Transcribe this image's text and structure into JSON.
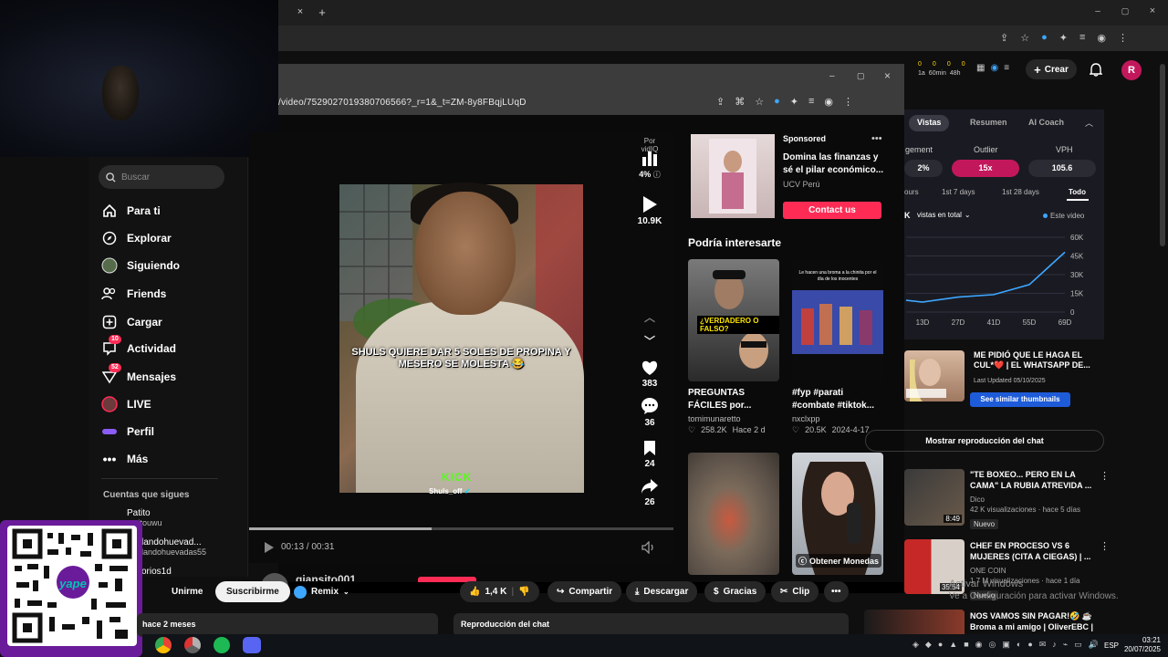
{
  "tiktok_sidebar": {
    "search_placeholder": "Buscar",
    "nav": [
      {
        "label": "Para ti"
      },
      {
        "label": "Explorar"
      },
      {
        "label": "Siguiendo"
      },
      {
        "label": "Friends"
      },
      {
        "label": "Cargar"
      },
      {
        "label": "Actividad",
        "badge": "10"
      },
      {
        "label": "Mensajes",
        "badge": "52"
      },
      {
        "label": "LIVE"
      },
      {
        "label": "Perfil"
      },
      {
        "label": "Más"
      }
    ],
    "following_title": "Cuentas que sigues",
    "following": [
      {
        "name": "Patito",
        "handle": "patitouwu"
      },
      {
        "name": "landohuevad...",
        "handle": "landohuevadas55"
      },
      {
        "name": "orios1d",
        "handle": "orios1d"
      }
    ]
  },
  "browser": {
    "url": "/video/7529027019380706566?_r=1&_t=ZM-8y8FBqjLUqD"
  },
  "video": {
    "caption": "SHULS QUIERE DAR 5 SOLES DE PROPINA Y MESERO SE MOLESTA 😂",
    "watermark": "Shuls_off",
    "time": "00:13 / 00:31",
    "progress": 0.43,
    "uploader": "giansito001"
  },
  "rail": {
    "vidiq_label": "Por vidIQ",
    "vidiq_pct": "4%",
    "plays": "10.9K",
    "likes": "383",
    "comments": "36",
    "saves": "24",
    "shares": "26"
  },
  "ad": {
    "sponsored": "Sponsored",
    "title": "Domina las finanzas y sé el pilar económico...",
    "brand": "UCV Perú",
    "cta": "Contact us"
  },
  "recommendations": {
    "title": "Podría interesarte",
    "items": [
      {
        "caption": "PREGUNTAS FÁCILES por...",
        "user": "tomimunaretto",
        "likes": "258.2K",
        "date": "Hace 2 d",
        "overlay": "¿VERDADERO O FALSO?"
      },
      {
        "caption": "#fyp #parati #combate #tiktok...",
        "user": "nxclxpp",
        "likes": "20.5K",
        "date": "2024-4-17",
        "overlay": "Le hacen una broma a la chinita por el día de los inocentes"
      },
      {
        "caption": "",
        "user": "",
        "likes": "",
        "date": "",
        "overlay": ""
      },
      {
        "caption": "",
        "user": "",
        "likes": "",
        "date": "",
        "overlay": "Obtener Monedas"
      }
    ]
  },
  "youtube_actions": {
    "unsubscribe": "Unirme",
    "subscribe": "Suscribirme",
    "remix": "Remix",
    "likes": "1,4 K",
    "share": "Compartir",
    "download": "Descargar",
    "thanks": "Gracias",
    "clip": "Clip",
    "date_partial": "hace 2 meses",
    "chat_replay": "Reproducción del chat"
  },
  "youtube_header": {
    "create": "Crear",
    "avatar_letter": "R",
    "stats": [
      "0",
      "0",
      "0",
      "0"
    ],
    "stat_labels": [
      "1a",
      "60min",
      "48h"
    ]
  },
  "vidiq": {
    "tabs": [
      "Vistas",
      "Resumen",
      "AI Coach"
    ],
    "metric_headers": [
      "gement",
      "Outlier",
      "VPH"
    ],
    "metric_values": [
      "2%",
      "15x",
      "105.6"
    ],
    "ranges": [
      "ours",
      "1st 7 days",
      "1st 28 days",
      "Todo"
    ],
    "filter": "vistas en total",
    "legend": "Este video",
    "y_ticks": [
      "60K",
      "45K",
      "30K",
      "15K",
      "0"
    ],
    "x_ticks": [
      "13D",
      "27D",
      "41D",
      "55D",
      "69D"
    ],
    "similar_title": "ME PIDIÓ QUE LE HAGA EL CUL*❤️ | EL WHATSAPP DE...",
    "similar_updated": "Last Updated 05/10/2025",
    "similar_button": "See similar thumbnails"
  },
  "chart_data": {
    "type": "line",
    "x": [
      "13D",
      "27D",
      "41D",
      "55D",
      "69D"
    ],
    "series": [
      {
        "name": "Este video",
        "values": [
          8,
          12,
          14,
          22,
          48
        ]
      }
    ],
    "y_ticks": [
      "0",
      "15K",
      "30K",
      "45K",
      "60K"
    ],
    "ylim": [
      0,
      60
    ],
    "grid": true
  },
  "yt_sidebar": {
    "chat_button": "Mostrar reproducción del chat",
    "videos": [
      {
        "title": "\"TE BOXEO... PERO EN LA CAMA\" LA RUBIA ATREVIDA ...",
        "channel": "Dico",
        "meta": "42 K visualizaciones · hace 5 días",
        "badge": "Nuevo",
        "duration": "8:49"
      },
      {
        "title": "CHEF EN PROCESO VS 6 MUJERES (CITA A CIEGAS) | ...",
        "channel": "ONE COIN",
        "meta": "1,7 M visualizaciones · hace 1 día",
        "badge": "Nuevo",
        "duration": "35:54"
      },
      {
        "title": "NOS VAMOS SIN PAGAR!🤣 ☕ Broma a mi amigo | OliverEBC |",
        "channel": "",
        "meta": "",
        "badge": "",
        "duration": ""
      }
    ]
  },
  "windows": {
    "activate_1": "Activar Windows",
    "activate_2": "Ve a Configuración para activar Windows.",
    "lang": "ESP",
    "time": "03:21",
    "date": "20/07/2025"
  },
  "colors": {
    "accent": "#fe2c55",
    "youtube_red": "#ff0000",
    "vidiq_blue": "#3ea6ff"
  }
}
